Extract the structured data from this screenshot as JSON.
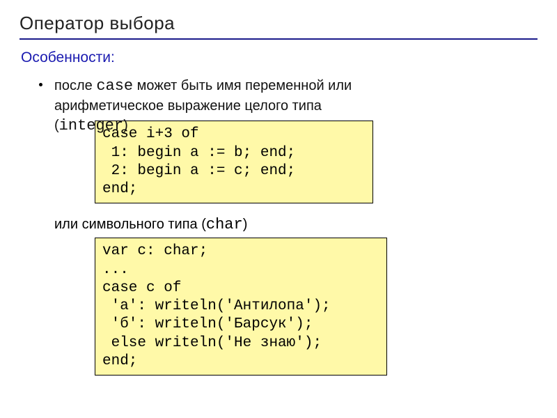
{
  "title": "Оператор выбора",
  "subhead": "Особенности:",
  "bullet": {
    "line1": "после ",
    "kw_case": "case",
    "line1b": " может быть имя переменной или",
    "line2": "арифметическое выражение целого типа",
    "line3_open": "(",
    "kw_integer": "integer",
    "line3_close": ")"
  },
  "code1": "case i+3 of\n 1: begin a := b; end;\n 2: begin a := c; end;\nend;",
  "cont": {
    "text1": "или символьного типа (",
    "kw_char": "char",
    "text2": ")"
  },
  "code2": "var c: char;\n...\ncase c of\n 'а': writeln('Антилопа');\n 'б': writeln('Барсук');\n else writeln('Не знаю');\nend;"
}
